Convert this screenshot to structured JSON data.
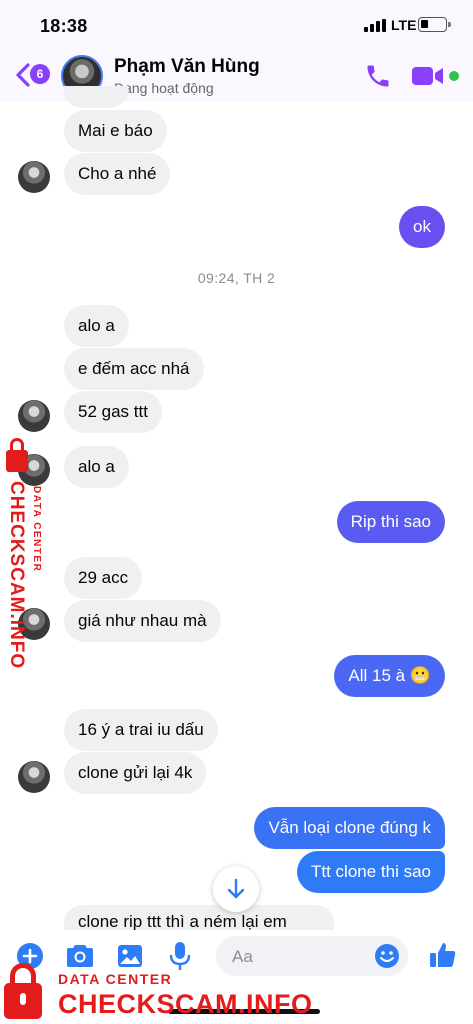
{
  "status_bar": {
    "time": "18:38",
    "network": "LTE"
  },
  "header": {
    "unread_count": "6",
    "contact_name": "Phạm Văn Hùng",
    "contact_status": "Đang hoạt động"
  },
  "timestamp": "09:24, TH 2",
  "messages": [
    {
      "text": "Mai e báo",
      "direction": "incoming"
    },
    {
      "text": "Cho a nhé",
      "direction": "incoming"
    },
    {
      "text": "ok",
      "direction": "outgoing"
    },
    {
      "text": "alo a",
      "direction": "incoming"
    },
    {
      "text": "e đếm acc nhá",
      "direction": "incoming"
    },
    {
      "text": "52 gas ttt",
      "direction": "incoming"
    },
    {
      "text": "alo a",
      "direction": "incoming"
    },
    {
      "text": "Rip thi sao",
      "direction": "outgoing"
    },
    {
      "text": "29 acc",
      "direction": "incoming"
    },
    {
      "text": "giá như nhau mà",
      "direction": "incoming"
    },
    {
      "text": "All 15 à 😬",
      "direction": "outgoing"
    },
    {
      "text": "16 ý a trai iu dấu",
      "direction": "incoming"
    },
    {
      "text": "clone gửi lại 4k",
      "direction": "incoming"
    },
    {
      "text": "Vẫn loại clone đúng k",
      "direction": "outgoing"
    },
    {
      "text": "Ttt clone thi sao",
      "direction": "outgoing"
    },
    {
      "text": "clone rip ttt thì a ném lại em",
      "direction": "incoming"
    }
  ],
  "composer": {
    "placeholder": "Aa"
  },
  "watermark": {
    "sub": "DATA CENTER",
    "brand": "CHECKSCAM.INFO"
  },
  "colors": {
    "accent": "#8a3ffc",
    "outgoing_bubble_top": "#5b5cf2",
    "outgoing_bubble_bottom": "#2e7cf6",
    "incoming_bubble": "#eff0f1",
    "online": "#31c24d",
    "watermark": "#e21b1b"
  },
  "icons": [
    "back-icon",
    "call-icon",
    "video-camera-icon",
    "arrow-down-icon",
    "plus-icon",
    "camera-icon",
    "image-icon",
    "microphone-icon",
    "emoji-icon",
    "like-icon",
    "lock-icon"
  ]
}
